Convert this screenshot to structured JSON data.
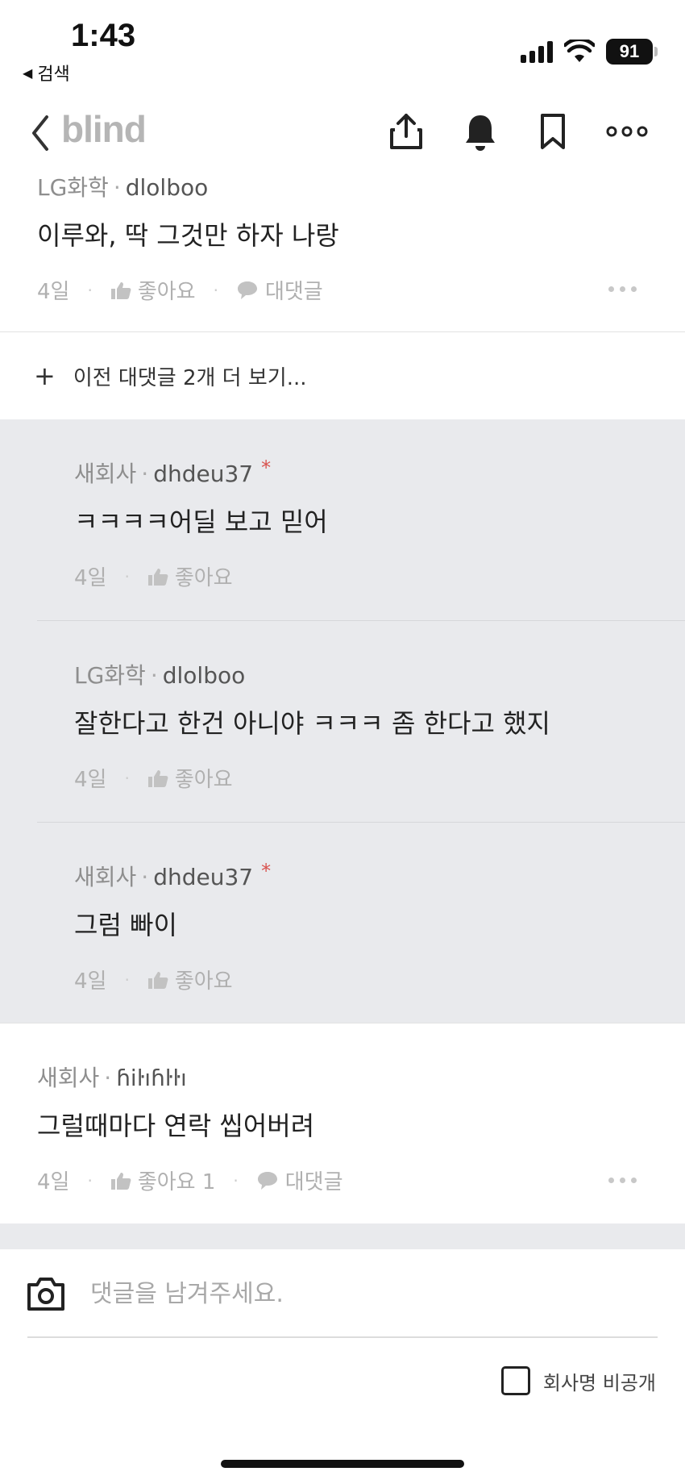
{
  "status_bar": {
    "time": "1:43",
    "back_label": "검색",
    "battery": "91"
  },
  "nav": {
    "brand": "blind"
  },
  "comments": [
    {
      "company": "LG화학",
      "user": "dlolboo",
      "text": "이루와, 딱 그것만 하자 나랑",
      "time": "4일",
      "like_label": "좋아요",
      "reply_label": "대댓글"
    },
    {
      "company": "새회사",
      "user": "ɦiŀıɦŀŀı",
      "text": "그럴때마다 연락 씹어버려",
      "time": "4일",
      "like_label": "좋아요 1",
      "reply_label": "대댓글"
    }
  ],
  "more_replies_label": "이전 대댓글 2개 더 보기...",
  "replies": [
    {
      "company": "새회사",
      "user": "dhdeu37",
      "star": "*",
      "text": "ㅋㅋㅋㅋ어딜 보고 믿어",
      "time": "4일",
      "like_label": "좋아요"
    },
    {
      "company": "LG화학",
      "user": "dlolboo",
      "text": "잘한다고 한건 아니야 ㅋㅋㅋ 좀 한다고 했지",
      "time": "4일",
      "like_label": "좋아요"
    },
    {
      "company": "새회사",
      "user": "dhdeu37",
      "star": "*",
      "text": "그럼 빠이",
      "time": "4일",
      "like_label": "좋아요"
    }
  ],
  "composer": {
    "placeholder": "댓글을 남겨주세요.",
    "private_label": "회사명 비공개"
  },
  "colors": {
    "reply_bg": "#e9eaed",
    "accent_star": "#d9534f",
    "brand_gray": "#b5b5b5"
  }
}
